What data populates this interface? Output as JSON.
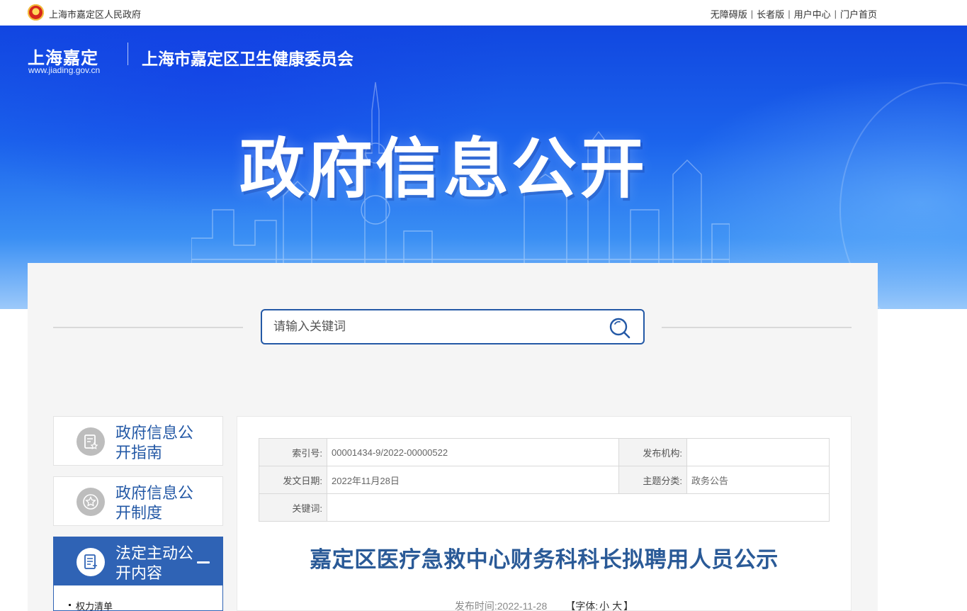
{
  "topbar": {
    "gov_name": "上海市嘉定区人民政府",
    "links": [
      "无障碍版",
      "长者版",
      "用户中心",
      "门户首页"
    ]
  },
  "header": {
    "logo_text": "上海嘉定",
    "logo_url": "www.jiading.gov.cn",
    "agency_name": "上海市嘉定区卫生健康委员会",
    "hero_title": "政府信息公开"
  },
  "search": {
    "placeholder": "请输入关键词"
  },
  "sidebar": {
    "items": [
      {
        "label": "政府信息公开指南",
        "icon": "document-star-icon"
      },
      {
        "label": "政府信息公开制度",
        "icon": "star-badge-icon"
      },
      {
        "label": "法定主动公开内容",
        "icon": "list-document-icon"
      }
    ],
    "sub_items": [
      "权力清单"
    ]
  },
  "meta": {
    "index_label": "索引号:",
    "index_value": "00001434-9/2022-00000522",
    "publisher_label": "发布机构:",
    "publisher_value": "",
    "date_label": "发文日期:",
    "date_value": "2022年11月28日",
    "topic_label": "主题分类:",
    "topic_value": "政务公告",
    "keywords_label": "关键词:",
    "keywords_value": ""
  },
  "article": {
    "title": "嘉定区医疗急救中心财务科科长拟聘用人员公示",
    "publish_label": "发布时间:",
    "publish_time": "2022-11-28",
    "font_label": "【字体:",
    "font_small": "小",
    "font_large": "大",
    "font_close": "】"
  },
  "colors": {
    "accent": "#2459a6",
    "sidebar_active": "#2f63b5",
    "title": "#2a5a97"
  }
}
